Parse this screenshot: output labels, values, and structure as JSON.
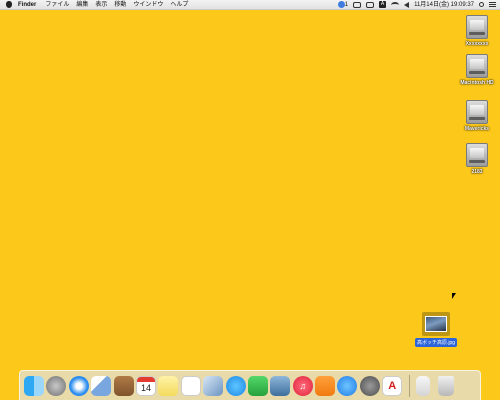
{
  "menubar": {
    "app_name": "Finder",
    "menus": [
      "ファイル",
      "編集",
      "表示",
      "移動",
      "ウインドウ",
      "ヘルプ"
    ],
    "status_badge": "1",
    "input_badge": "A",
    "clock": "11月14日(金)  19:09:37"
  },
  "desktop": {
    "drives": [
      {
        "label": "Xxxxxxxx"
      },
      {
        "label": "Macintosh HD"
      },
      {
        "label": "Mavericks"
      },
      {
        "label": "2183"
      }
    ],
    "selected_file": {
      "label": "高ボッチ高原.jpg"
    }
  },
  "dock": {
    "calendar_day": "14",
    "acrobat_glyph": "A",
    "items": [
      "finder-icon",
      "launchpad-icon",
      "safari-icon",
      "mail-icon",
      "contacts-icon",
      "calendar-icon",
      "notes-icon",
      "reminders-icon",
      "preview-icon",
      "messages-icon",
      "facetime-icon",
      "iphoto-icon",
      "itunes-icon",
      "ibooks-icon",
      "app-store-icon",
      "system-preferences-icon",
      "acrobat-icon",
      "documents-folder-icon",
      "trash-icon"
    ]
  },
  "colors": {
    "desktop": "#FCC81A",
    "selection": "#2B63D8"
  }
}
